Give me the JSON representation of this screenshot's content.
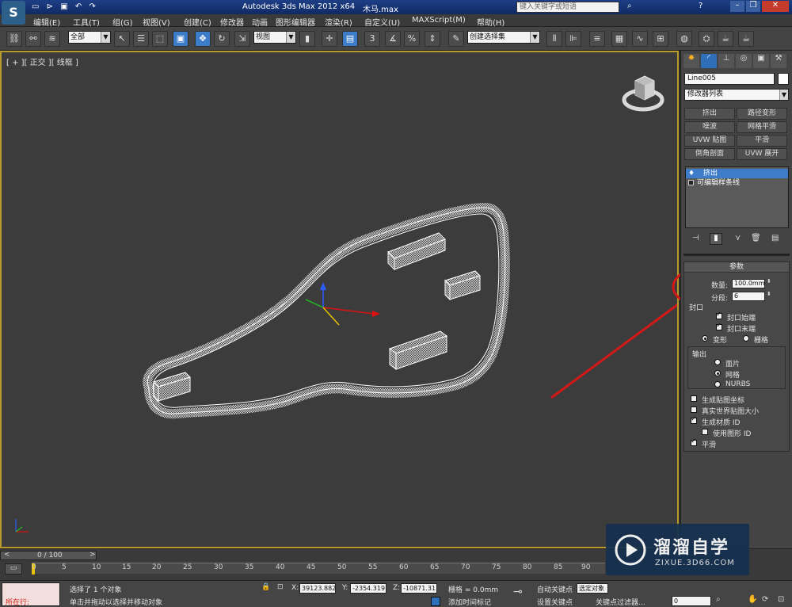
{
  "title_bar": {
    "app_title": "Autodesk 3ds Max  2012 x64",
    "file_name": "木马.max",
    "search_placeholder": "键入关键字或短语"
  },
  "menu": [
    "编辑(E)",
    "工具(T)",
    "组(G)",
    "视图(V)",
    "创建(C)",
    "修改器",
    "动画",
    "图形编辑器",
    "渲染(R)",
    "自定义(U)",
    "MAXScript(M)",
    "帮助(H)"
  ],
  "toolbar": {
    "selection_filter": "全部",
    "ref_coord": "视图",
    "snap_label": "3",
    "named_selection": "创建选择集"
  },
  "viewport": {
    "label": "[ + ][ 正交 ][ 线框 ]"
  },
  "command_panel": {
    "object_name": "Line005",
    "modifier_list": "修改器列表",
    "modifier_buttons": [
      "挤出",
      "路径变形",
      "噪波",
      "网格平滑",
      "UVW 贴图",
      "平滑",
      "倒角剖面",
      "UVW 展开"
    ],
    "stack": [
      "挤出",
      "可编辑样条线"
    ],
    "params": {
      "title": "参数",
      "amount_label": "数量:",
      "amount_value": "100.0mm",
      "segments_label": "分段:",
      "segments_value": "6",
      "capping_title": "封口",
      "cap_start": "封口始端",
      "cap_end": "封口末端",
      "morph": "变形",
      "grid": "栅格",
      "output_title": "输出",
      "patch": "面片",
      "mesh": "网格",
      "nurbs": "NURBS",
      "gen_map": "生成贴图坐标",
      "real_world": "真实世界贴图大小",
      "gen_mat": "生成材质 ID",
      "use_shape": "使用图形 ID",
      "smooth": "平滑"
    }
  },
  "timeline": {
    "frame_counter": "0 / 100",
    "ticks": [
      "0",
      "5",
      "10",
      "15",
      "20",
      "25",
      "30",
      "35",
      "40",
      "45",
      "50",
      "55",
      "60",
      "65",
      "70",
      "75",
      "80",
      "85",
      "90"
    ]
  },
  "status": {
    "running": "所在行:",
    "selected": "选择了 1 个对象",
    "hint": "单击并拖动以选择并移动对象",
    "x_label": "X:",
    "x_value": "39123.882",
    "y_label": "Y:",
    "y_value": "-2354.319",
    "z_label": "Z:",
    "z_value": "-10871.31",
    "grid": "栅格 = 0.0mm",
    "auto_key": "自动关键点",
    "selected_obj": "选定对象",
    "set_key": "设置关键点",
    "key_filter": "关键点过滤器...",
    "add_time_tag": "添加时间标记",
    "frame": "0"
  },
  "watermark": {
    "brand": "溜溜自学",
    "url": "ZIXUE.3D66.COM"
  },
  "colors": {
    "highlight_ring": "#d41818",
    "arrow": "#d41818",
    "viewport_bg": "#3c3c3c",
    "active_border": "#b89b2a"
  }
}
